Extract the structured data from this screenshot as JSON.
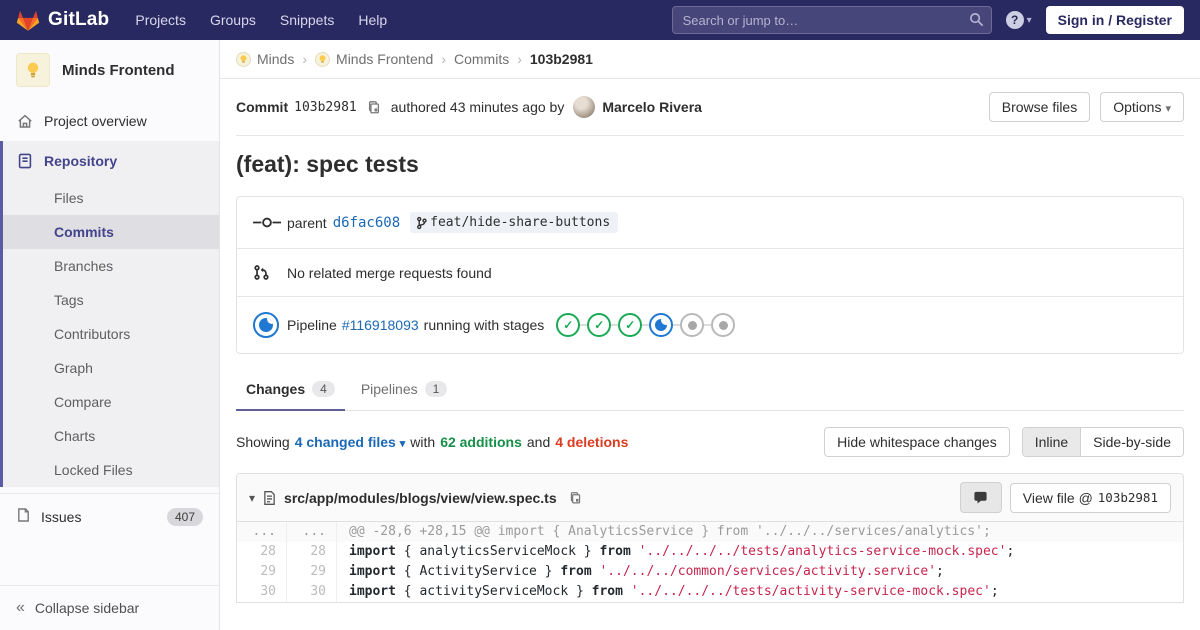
{
  "colors": {
    "navbar_bg": "#292961",
    "accent": "#44448c",
    "link_blue": "#1b69b6",
    "green": "#168f48",
    "red": "#db3b21",
    "string": "#c7254e",
    "passed": "#1aaa55",
    "running": "#1f78d1"
  },
  "navbar": {
    "logo_text": "GitLab",
    "links": [
      "Projects",
      "Groups",
      "Snippets",
      "Help"
    ],
    "search_placeholder": "Search or jump to…",
    "help_glyph": "?",
    "sign_in_label": "Sign in / Register"
  },
  "sidebar": {
    "project_name": "Minds Frontend",
    "overview_label": "Project overview",
    "repository_label": "Repository",
    "repo_items": [
      "Files",
      "Commits",
      "Branches",
      "Tags",
      "Contributors",
      "Graph",
      "Compare",
      "Charts",
      "Locked Files"
    ],
    "active_repo_item": "Commits",
    "issues_label": "Issues",
    "issues_count": "407",
    "collapse_label": "Collapse sidebar",
    "collapse_glyph": "«"
  },
  "breadcrumb": {
    "items": [
      "Minds",
      "Minds Frontend",
      "Commits",
      "103b2981"
    ],
    "avatar_count": 2
  },
  "commit": {
    "label": "Commit",
    "sha": "103b2981",
    "authored_text": "authored 43 minutes ago by",
    "author": "Marcelo Rivera",
    "browse_files_label": "Browse files",
    "options_label": "Options",
    "title": "(feat): spec tests",
    "parent_label": "parent",
    "parent_sha": "d6fac608",
    "branch": "feat/hide-share-buttons",
    "mr_text": "No related merge requests found",
    "pipeline_label": "Pipeline",
    "pipeline_id": "#116918093",
    "pipeline_status_text": "running with stages",
    "stages": [
      "passed",
      "passed",
      "passed",
      "running",
      "created",
      "created"
    ]
  },
  "tabs": [
    {
      "label": "Changes",
      "count": "4",
      "active": true
    },
    {
      "label": "Pipelines",
      "count": "1",
      "active": false
    }
  ],
  "summary": {
    "showing": "Showing",
    "changed_files": "4 changed files",
    "with": "with",
    "additions": "62 additions",
    "and": "and",
    "deletions": "4 deletions",
    "hide_whitespace_label": "Hide whitespace changes",
    "inline_label": "Inline",
    "side_by_side_label": "Side-by-side"
  },
  "diff": {
    "file_path": "src/app/modules/blogs/view/view.spec.ts",
    "view_file_label": "View file @",
    "view_file_sha": "103b2981",
    "rows": [
      {
        "type": "match",
        "old": "...",
        "new": "...",
        "segments": [
          {
            "t": "@@ -28,6 +28,15 @@ import { AnalyticsService } from '../../../services/analytics';",
            "c": "m"
          }
        ]
      },
      {
        "type": "ctx",
        "old": "28",
        "new": "28",
        "segments": [
          {
            "t": "import",
            "c": "k"
          },
          {
            "t": " { analyticsServiceMock } ",
            "c": "p"
          },
          {
            "t": "from",
            "c": "k"
          },
          {
            "t": " ",
            "c": "p"
          },
          {
            "t": "'../../../../tests/analytics-service-mock.spec'",
            "c": "s"
          },
          {
            "t": ";",
            "c": "p"
          }
        ]
      },
      {
        "type": "ctx",
        "old": "29",
        "new": "29",
        "segments": [
          {
            "t": "import",
            "c": "k"
          },
          {
            "t": " { ActivityService } ",
            "c": "p"
          },
          {
            "t": "from",
            "c": "k"
          },
          {
            "t": " ",
            "c": "p"
          },
          {
            "t": "'../../../common/services/activity.service'",
            "c": "s"
          },
          {
            "t": ";",
            "c": "p"
          }
        ]
      },
      {
        "type": "ctx",
        "old": "30",
        "new": "30",
        "segments": [
          {
            "t": "import",
            "c": "k"
          },
          {
            "t": " { activityServiceMock } ",
            "c": "p"
          },
          {
            "t": "from",
            "c": "k"
          },
          {
            "t": " ",
            "c": "p"
          },
          {
            "t": "'../../../../tests/activity-service-mock.spec'",
            "c": "s"
          },
          {
            "t": ";",
            "c": "p"
          }
        ]
      }
    ]
  }
}
